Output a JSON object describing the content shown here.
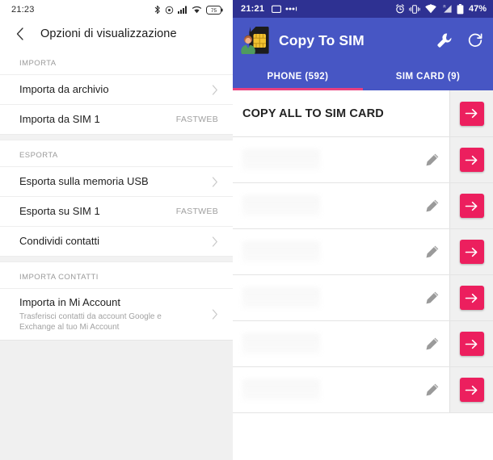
{
  "left_screen": {
    "status_bar": {
      "clock": "21:23",
      "icons": [
        "bluetooth-icon",
        "dnd-icon",
        "cellular-signal-icon",
        "wifi-icon",
        "battery-icon"
      ],
      "battery_level": "75"
    },
    "app_bar": {
      "back_icon": "chevron-left-icon",
      "title": "Opzioni di visualizzazione"
    },
    "sections": [
      {
        "header": "IMPORTA",
        "rows": [
          {
            "title": "Importa da archivio",
            "subtitle": "",
            "value": "",
            "chevron": true
          },
          {
            "title": "Importa da SIM 1",
            "subtitle": "",
            "value": "FASTWEB",
            "chevron": false
          }
        ]
      },
      {
        "header": "ESPORTA",
        "rows": [
          {
            "title": "Esporta sulla memoria USB",
            "subtitle": "",
            "value": "",
            "chevron": true
          },
          {
            "title": "Esporta su SIM 1",
            "subtitle": "",
            "value": "FASTWEB",
            "chevron": false
          },
          {
            "title": "Condividi contatti",
            "subtitle": "",
            "value": "",
            "chevron": true
          }
        ]
      },
      {
        "header": "IMPORTA CONTATTI",
        "rows": [
          {
            "title": "Importa in Mi Account",
            "subtitle": "Trasferisci contatti da account Google e Exchange al tuo Mi Account",
            "value": "",
            "chevron": true
          }
        ]
      }
    ]
  },
  "right_screen": {
    "status_bar": {
      "clock": "21:21",
      "left_icons": [
        "screenshot-icon",
        "more-dots-icon"
      ],
      "right_icons": [
        "alarm-icon",
        "vibrate-icon",
        "wifi-icon",
        "roaming-signal-icon",
        "battery-icon"
      ],
      "battery_text": "47%"
    },
    "app_bar": {
      "icon": "sim-contact-icon",
      "title": "Copy To SIM",
      "actions": [
        {
          "name": "settings-wrench-icon",
          "label": "Settings"
        },
        {
          "name": "refresh-icon",
          "label": "Refresh"
        }
      ]
    },
    "tabs": [
      {
        "label": "PHONE (592)",
        "active": true
      },
      {
        "label": "SIM CARD (9)",
        "active": false
      }
    ],
    "copy_all_row": {
      "label": "COPY ALL TO SIM CARD",
      "action_icon": "arrow-right-icon"
    },
    "contacts": [
      {
        "name": "",
        "edit_icon": "pencil-icon",
        "action_icon": "arrow-right-icon"
      },
      {
        "name": "",
        "edit_icon": "pencil-icon",
        "action_icon": "arrow-right-icon"
      },
      {
        "name": "",
        "edit_icon": "pencil-icon",
        "action_icon": "arrow-right-icon"
      },
      {
        "name": "",
        "edit_icon": "pencil-icon",
        "action_icon": "arrow-right-icon"
      },
      {
        "name": "",
        "edit_icon": "pencil-icon",
        "action_icon": "arrow-right-icon"
      },
      {
        "name": "",
        "edit_icon": "pencil-icon",
        "action_icon": "arrow-right-icon"
      }
    ]
  },
  "colors": {
    "status_bar_blue": "#2e3192",
    "app_bar_blue": "#4756c4",
    "accent_pink": "#ec1f5e",
    "tab_underline_pink": "#e9407f",
    "left_bg_gray": "#f0f0f0"
  }
}
